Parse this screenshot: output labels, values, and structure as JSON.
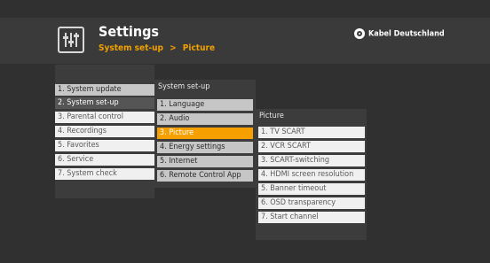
{
  "header": {
    "title": "Settings",
    "breadcrumb": [
      "System set-up",
      ">",
      "Picture"
    ],
    "brand": "Kabel Deutschland"
  },
  "menu_main": {
    "items": [
      "1. System update",
      "2. System set-up",
      "3. Parental control",
      "4. Recordings",
      "5. Favorites",
      "6. Service",
      "7. System check"
    ],
    "selected_index": 1
  },
  "menu_setup": {
    "header": "System set-up",
    "items": [
      "1. Language",
      "2. Audio",
      "3. Picture",
      "4. Energy settings",
      "5. Internet",
      "6. Remote Control App"
    ],
    "selected_index": 2
  },
  "menu_picture": {
    "header": "Picture",
    "items": [
      "1. TV SCART",
      "2. VCR SCART",
      "3. SCART-switching",
      "4. HDMI screen resolution",
      "5. Banner timeout",
      "6. OSD transparency",
      "7. Start channel"
    ]
  },
  "colors": {
    "accent": "#f5a000",
    "background": "#303030",
    "item": "#f0f0f0",
    "selected_parent": "#555555"
  },
  "icons": {
    "settings": "sliders-icon",
    "brand": "kabel-deutschland-logo-icon"
  }
}
